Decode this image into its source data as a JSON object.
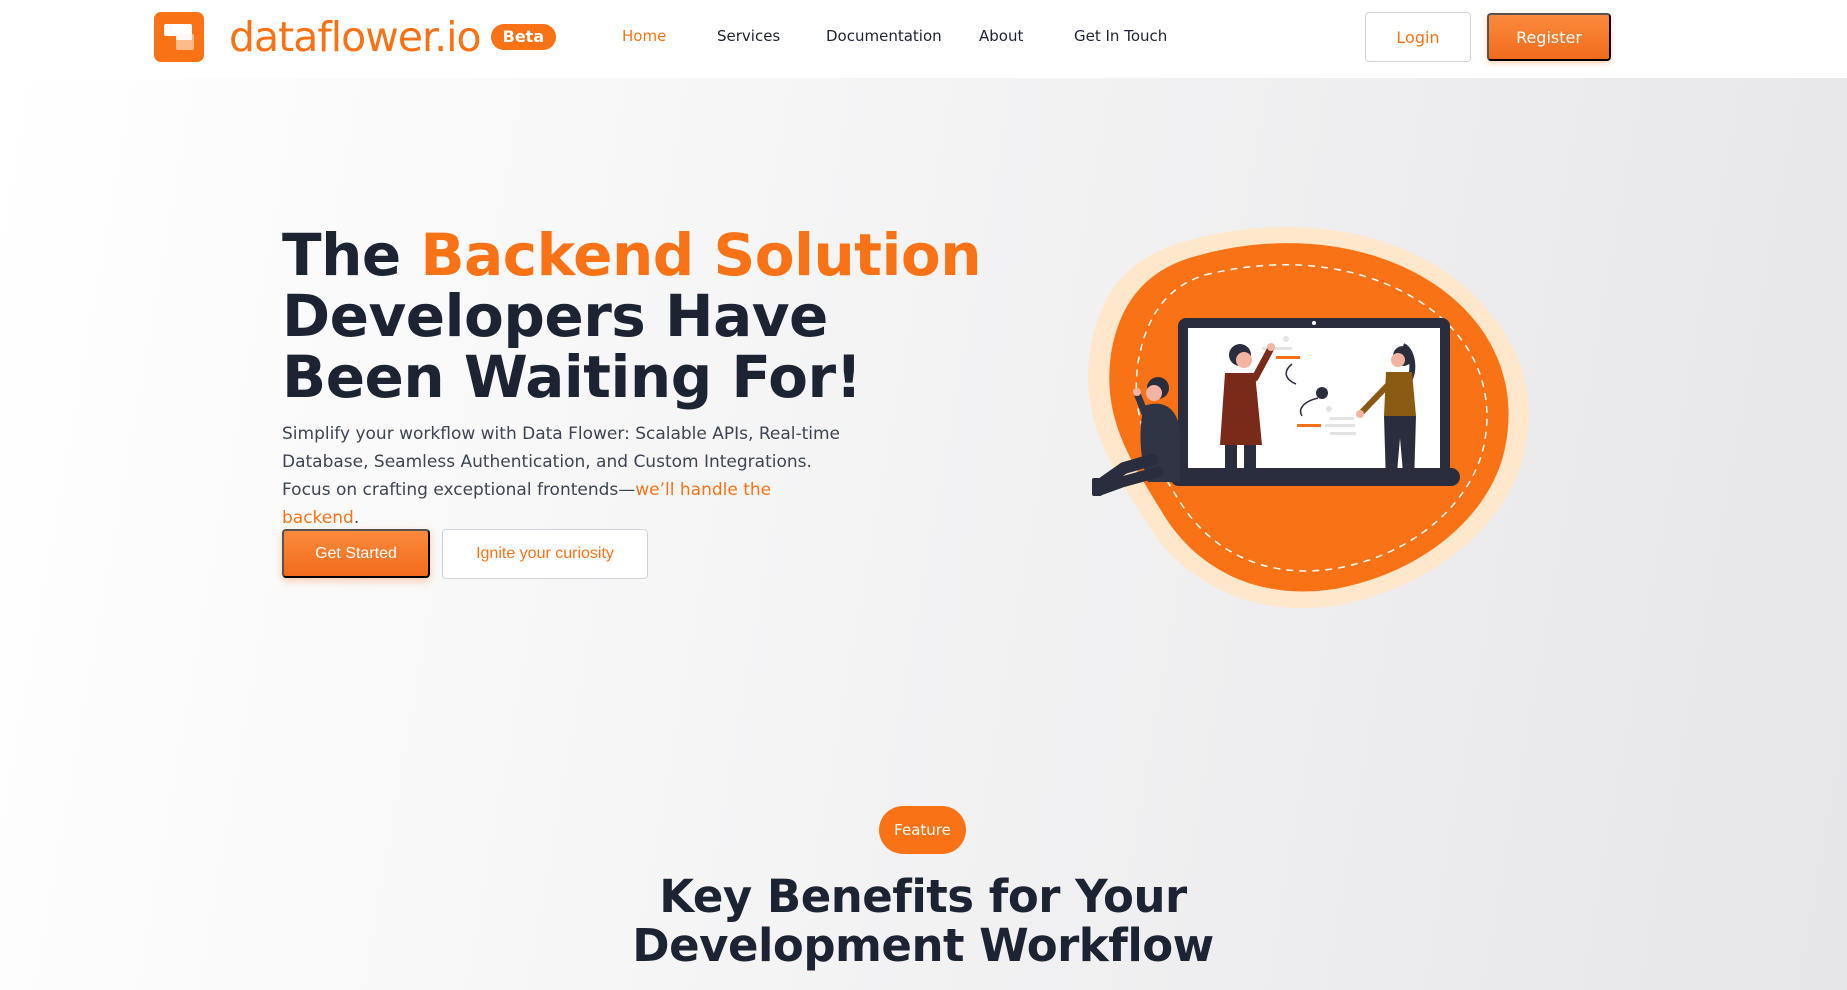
{
  "brand": {
    "name": "dataflower.io",
    "badge": "Beta",
    "logo_icon": "stacked-cards-logo-icon",
    "accent_color": "#f97316"
  },
  "nav": {
    "items": [
      {
        "label": "Home",
        "active": true
      },
      {
        "label": "Services",
        "active": false
      },
      {
        "label": "Documentation",
        "active": false
      },
      {
        "label": "About",
        "active": false
      },
      {
        "label": "Get In Touch",
        "active": false
      }
    ],
    "login_label": "Login",
    "register_label": "Register"
  },
  "hero": {
    "headline_prefix": "The ",
    "headline_accent": "Backend Solution",
    "headline_rest": "Developers Have Been Waiting For!",
    "subtext_main": "Simplify your workflow with Data Flower: Scalable APIs, Real-time Database, Seamless Authentication, and Custom Integrations. Focus on crafting exceptional frontends—",
    "subtext_accent": "we’ll handle the backend",
    "subtext_end": ".",
    "primary_cta": "Get Started",
    "secondary_cta": "Ignite your curiosity",
    "illustration_icon": "team-presentation-illustration"
  },
  "features": {
    "badge": "Feature",
    "title_line1": "Key Benefits for Your",
    "title_line2": "Development Workflow"
  },
  "colors": {
    "accent": "#f97316",
    "dark_text": "#1c2333",
    "body_text": "#3d4452"
  }
}
